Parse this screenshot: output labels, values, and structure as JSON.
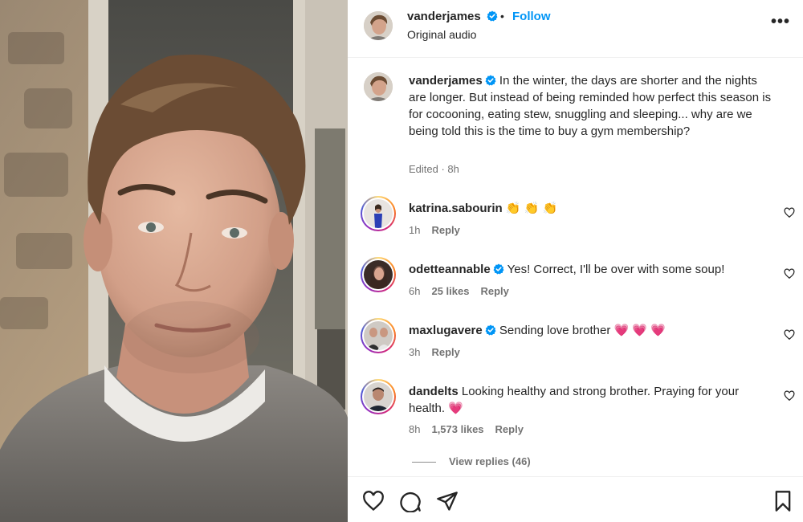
{
  "post": {
    "author": "vanderjames",
    "follow_label": "Follow",
    "dot": "•",
    "subtitle": "Original audio",
    "more": "•••"
  },
  "caption": {
    "author": "vanderjames",
    "text": "In the winter, the days are shorter and the nights are longer. But instead of being reminded how perfect this season is for cocooning, eating stew, snuggling and sleeping... why are we being told this is the time to buy a gym membership?",
    "meta": "Edited · 8h"
  },
  "comments": [
    {
      "user": "katrina.sabourin",
      "verified": false,
      "text": "👏 👏 👏",
      "time": "1h",
      "likes": "",
      "reply": "Reply"
    },
    {
      "user": "odetteannable",
      "verified": true,
      "text": "Yes! Correct, I'll be over with some soup!",
      "time": "6h",
      "likes": "25 likes",
      "reply": "Reply"
    },
    {
      "user": "maxlugavere",
      "verified": true,
      "text": "Sending love brother 💗 💗 💗",
      "time": "3h",
      "likes": "",
      "reply": "Reply"
    },
    {
      "user": "dandelts",
      "verified": false,
      "text": "Looking healthy and strong brother. Praying for your health. 💗",
      "time": "8h",
      "likes": "1,573 likes",
      "reply": "Reply"
    }
  ],
  "view_replies": "View replies (46)",
  "colors": {
    "accent": "#0095f6",
    "verified": "#0095f6",
    "muted": "#737373"
  },
  "icons": [
    "heart-icon",
    "comment-icon",
    "share-icon",
    "bookmark-icon",
    "more-options-icon",
    "verified-badge-icon"
  ]
}
